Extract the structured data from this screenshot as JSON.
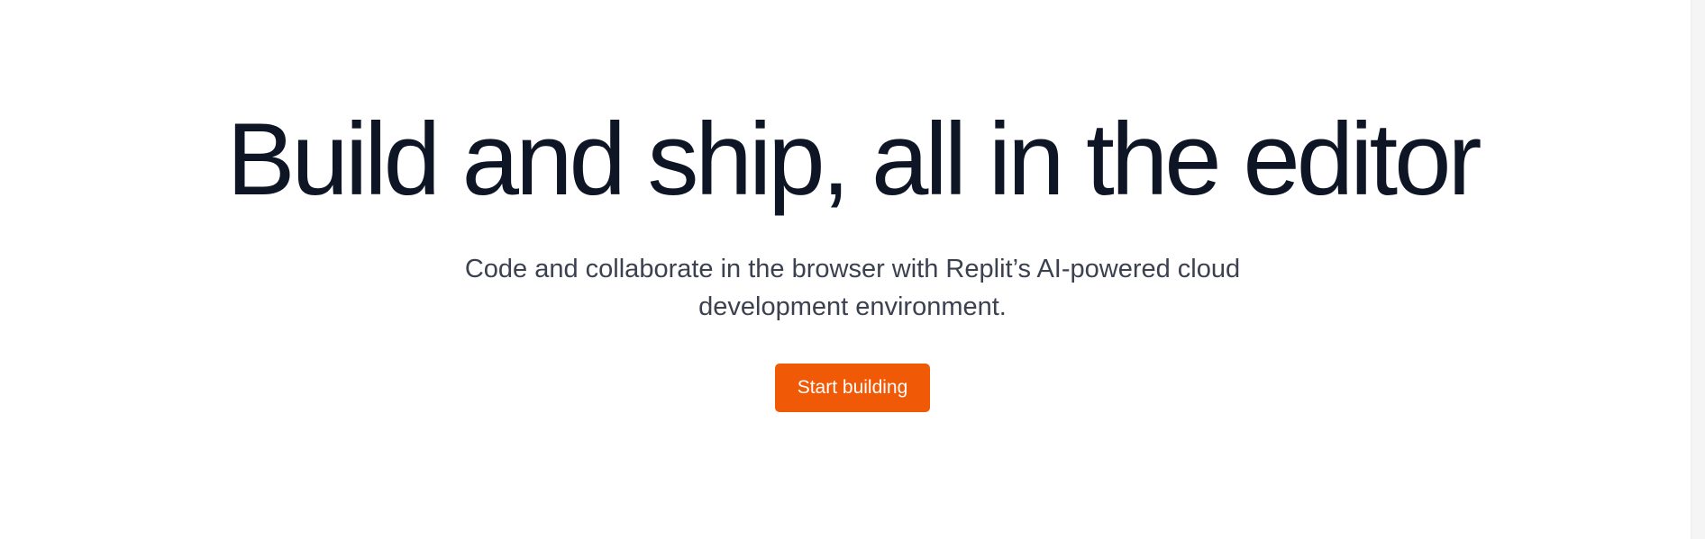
{
  "hero": {
    "title": "Build and ship, all in the editor",
    "subtitle": "Code and collaborate in the browser with Replit’s AI-powered cloud development environment.",
    "cta_label": "Start building"
  },
  "colors": {
    "background": "#ffffff",
    "title": "#0e1525",
    "subtitle": "#3c4150",
    "cta_background": "#f05a07",
    "cta_text": "#ffffff"
  }
}
